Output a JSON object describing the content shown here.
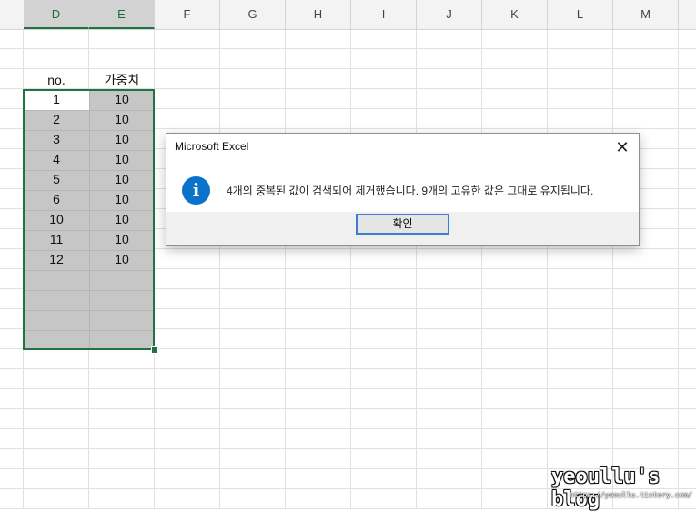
{
  "columns": [
    "D",
    "E",
    "F",
    "G",
    "H",
    "I",
    "J",
    "K",
    "L",
    "M"
  ],
  "selected_columns": [
    "D",
    "E"
  ],
  "table": {
    "headers": [
      "no.",
      "가중치"
    ],
    "rows": [
      [
        "1",
        "10"
      ],
      [
        "2",
        "10"
      ],
      [
        "3",
        "10"
      ],
      [
        "4",
        "10"
      ],
      [
        "5",
        "10"
      ],
      [
        "6",
        "10"
      ],
      [
        "10",
        "10"
      ],
      [
        "11",
        "10"
      ],
      [
        "12",
        "10"
      ],
      [
        "",
        ""
      ],
      [
        "",
        ""
      ],
      [
        "",
        ""
      ],
      [
        "",
        ""
      ]
    ]
  },
  "dialog": {
    "title": "Microsoft Excel",
    "close_glyph": "✕",
    "icon": "info-icon",
    "icon_glyph": "i",
    "message": "4개의 중복된 값이 검색되어 제거했습니다. 9개의 고유한 값은 그대로 유지됩니다.",
    "ok_label": "확인"
  },
  "watermark": {
    "main": "yeoullu's blog",
    "sub": "https://yeoullu.tistory.com/"
  },
  "colors": {
    "selection_border": "#217346",
    "info_icon": "#0b72c9",
    "button_focus": "#3a7fd4"
  }
}
